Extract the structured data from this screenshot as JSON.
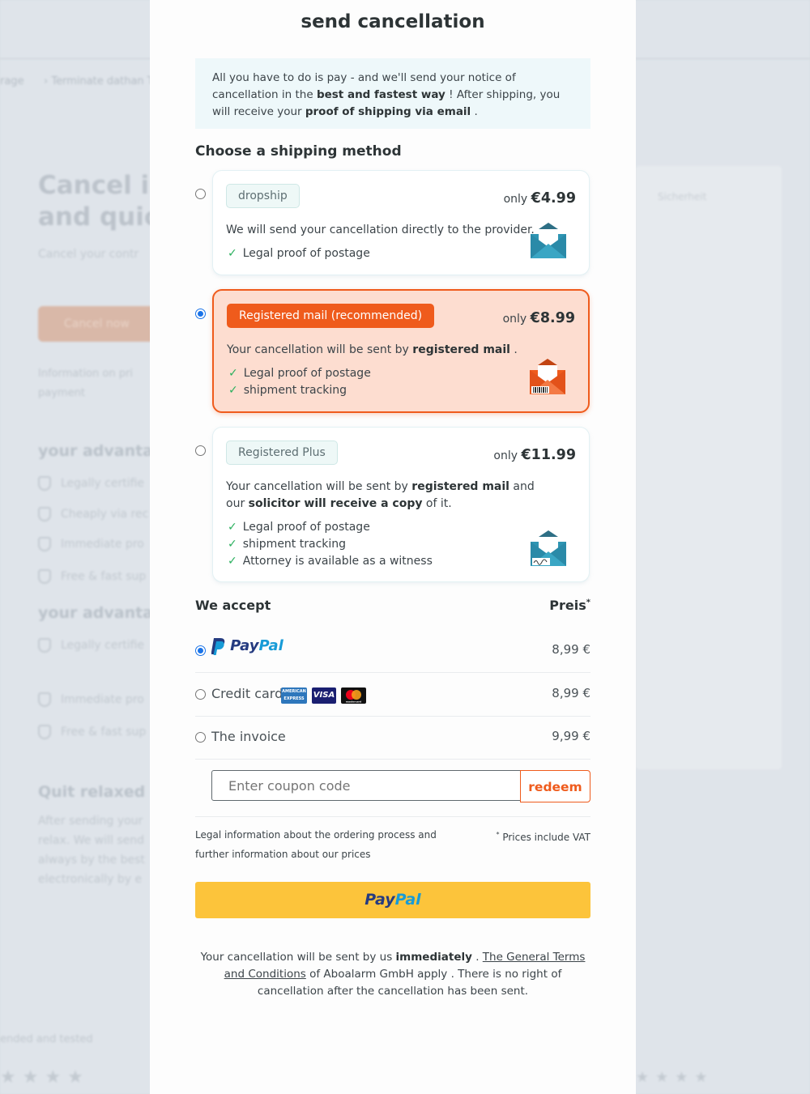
{
  "modal": {
    "title": "send cancellation",
    "intro": {
      "part1": "All you have to do is pay - and we'll send your notice of cancellation in the ",
      "bold1": "best and fastest way",
      "part2": " ! After shipping, you will receive your ",
      "bold2": "proof of shipping via email",
      "part3": " ."
    },
    "shipping_heading": "Choose a shipping method",
    "shipping_options": [
      {
        "tag": "dropship",
        "price_prefix": "only",
        "price": "€4.99",
        "selected": false,
        "desc_part1": "We will send your cancellation directly to the provider.",
        "features": [
          "Legal proof of postage"
        ],
        "icon": "envelope-icon"
      },
      {
        "tag": "Registered mail (recommended)",
        "price_prefix": "only",
        "price": "€8.99",
        "selected": true,
        "desc_part1": "Your cancellation will be sent by ",
        "desc_bold1": "registered mail",
        "desc_part2": " .",
        "features": [
          "Legal proof of postage",
          "shipment tracking"
        ],
        "icon": "registered-envelope-icon"
      },
      {
        "tag": "Registered Plus",
        "price_prefix": "only",
        "price": "€11.99",
        "selected": false,
        "desc_part1": "Your cancellation will be sent by ",
        "desc_bold1": "registered mail",
        "desc_part2": " and our ",
        "desc_bold2": "solicitor will receive a copy",
        "desc_part3": " of it.",
        "features": [
          "Legal proof of postage",
          "shipment tracking",
          "Attorney is available as a witness"
        ],
        "icon": "signed-envelope-icon"
      }
    ],
    "accept_heading": "We accept",
    "price_heading": "Preis",
    "price_heading_mark": "*",
    "payment_methods": [
      {
        "label": "PayPal",
        "amount": "8,99 €",
        "selected": true,
        "logo_a": "Pay",
        "logo_b": "Pal"
      },
      {
        "label": "Credit card",
        "amount": "8,99 €",
        "selected": false,
        "cards": [
          "AMERICAN EXPRESS",
          "VISA",
          "mastercard"
        ]
      },
      {
        "label": "The invoice",
        "amount": "9,99 €",
        "selected": false
      }
    ],
    "coupon": {
      "placeholder": "Enter coupon code",
      "button": "redeem"
    },
    "legal_text": "Legal information about the ordering process and further information about our prices",
    "vat_mark": "*",
    "vat_text": " Prices include VAT",
    "paypal_button": {
      "a": "Pay",
      "b": "Pal"
    },
    "footnote": {
      "part1": "Your cancellation will be sent by us ",
      "bold1": "immediately",
      "part2": " . ",
      "link": "The General Terms and Conditions",
      "part3": " of Aboalarm GmbH apply . There is no right of cancellation after the cancellation has been sent."
    }
  },
  "colors": {
    "accent": "#ef5b1c",
    "selected_card_bg": "#fdddd0",
    "paypal_yellow": "#fcc43b",
    "check_green": "#2bb05e",
    "radio_blue": "#1a73e8"
  }
}
